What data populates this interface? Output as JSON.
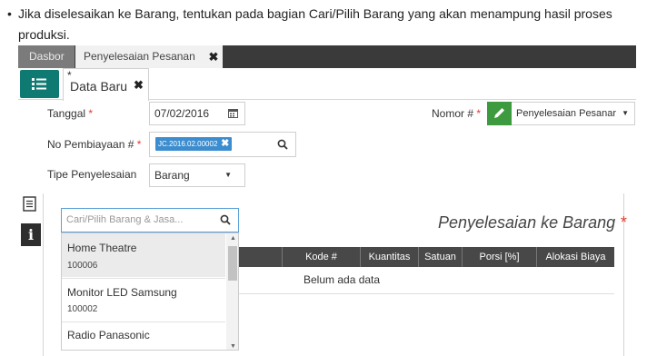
{
  "intro": {
    "bullet": "•",
    "text": "Jika diselesaikan ke Barang, tentukan pada bagian Cari/Pilih Barang yang akan menampung hasil proses produksi."
  },
  "tabs": {
    "dasbor": "Dasbor",
    "active": "Penyelesaian Pesanan",
    "close": "✖"
  },
  "doc_tab": {
    "modified": "*",
    "label": "Data Baru",
    "close": "✖"
  },
  "form": {
    "tanggal_label": "Tanggal",
    "tanggal_value": "07/02/2016",
    "nomor_label": "Nomor #",
    "nomor_value": "Penyelesaian Pesanar",
    "no_pembiayaan_label": "No Pembiayaan #",
    "no_pembiayaan_chip": "JC.2016.02.00002",
    "tipe_label": "Tipe Penyelesaian",
    "tipe_value": "Barang",
    "required_mark": "*"
  },
  "search": {
    "placeholder": "Cari/Pilih Barang & Jasa..."
  },
  "section_title": "Penyelesaian ke Barang",
  "table": {
    "columns": [
      "Kode #",
      "Kuantitas",
      "Satuan",
      "Porsi [%]",
      "Alokasi Biaya"
    ],
    "empty_text": "Belum ada data"
  },
  "dropdown": {
    "items": [
      {
        "name": "Home Theatre",
        "code": "100006"
      },
      {
        "name": "Monitor LED Samsung",
        "code": "100002"
      },
      {
        "name": "Radio Panasonic",
        "code": ""
      }
    ]
  },
  "colors": {
    "menu_button": "#0f7a72",
    "pencil_button": "#3e9a3e",
    "chip": "#3c8dd0",
    "required": "#e03b2f",
    "table_header": "#484848"
  }
}
